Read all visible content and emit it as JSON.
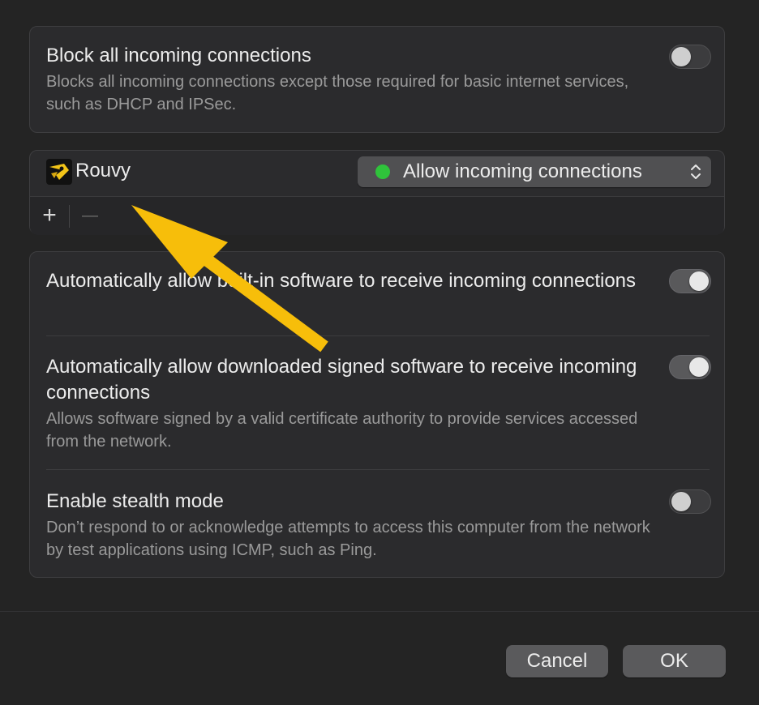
{
  "block_panel": {
    "title": "Block all incoming connections",
    "description": "Blocks all incoming connections except those required for basic internet services, such as DHCP and IPSec.",
    "toggle": false
  },
  "apps": {
    "items": [
      {
        "name": "Rouvy",
        "status": "Allow incoming connections",
        "status_color": "#2fc33b"
      }
    ],
    "add_label": "+",
    "remove_label": "—"
  },
  "settings": [
    {
      "title": "Automatically allow built-in software to receive incoming connections",
      "description": "",
      "toggle": true
    },
    {
      "title": "Automatically allow downloaded signed software to receive incoming connections",
      "description": "Allows software signed by a valid certificate authority to provide services accessed from the network.",
      "toggle": true
    },
    {
      "title": "Enable stealth mode",
      "description": "Don’t respond to or acknowledge attempts to access this computer from the network by test applications using ICMP, such as Ping.",
      "toggle": false
    }
  ],
  "footer": {
    "cancel_label": "Cancel",
    "ok_label": "OK"
  },
  "annotation": {
    "arrow_color": "#f7be0a"
  }
}
